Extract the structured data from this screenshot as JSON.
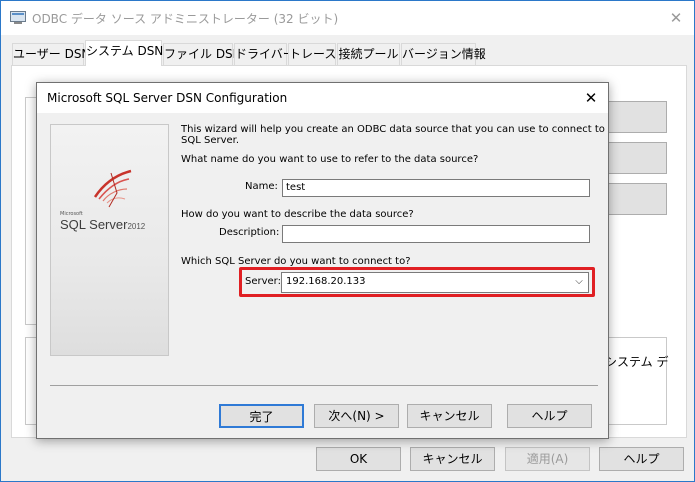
{
  "outer": {
    "title": "ODBC データ ソース アドミニストレーター (32 ビット)",
    "close_glyph": "✕",
    "tabs": [
      {
        "label": "ユーザー DSN"
      },
      {
        "label": "システム DSN"
      },
      {
        "label": "ファイル DSN"
      },
      {
        "label": "ドライバー"
      },
      {
        "label": "トレース"
      },
      {
        "label": "接続プール"
      },
      {
        "label": "バージョン情報"
      }
    ],
    "info_text": "システム デ",
    "buttons": {
      "ok": "OK",
      "cancel": "キャンセル",
      "apply": "適用(A)",
      "help": "ヘルプ"
    }
  },
  "dialog": {
    "title": "Microsoft SQL Server DSN Configuration",
    "close_glyph": "✕",
    "splash": {
      "microsoft": "Microsoft",
      "product": "SQL Server",
      "version": "2012"
    },
    "intro": "This wizard will help you create an ODBC data source that you can use to connect to",
    "intro_cont": "SQL Server.",
    "name_question": "What name do you want to use to refer to the data source?",
    "name_label": "Name:",
    "name_value": "test",
    "desc_question": "How do you want to describe the data source?",
    "desc_label": "Description:",
    "desc_value": "",
    "server_question": "Which SQL Server do you want to connect to?",
    "server_label": "Server:",
    "server_value": "192.168.20.133",
    "buttons": {
      "finish": "完了",
      "next": "次へ(N) >",
      "cancel": "キャンセル",
      "help": "ヘルプ"
    }
  },
  "colors": {
    "highlight": "#e01f23",
    "window_border": "#2b78c9"
  }
}
